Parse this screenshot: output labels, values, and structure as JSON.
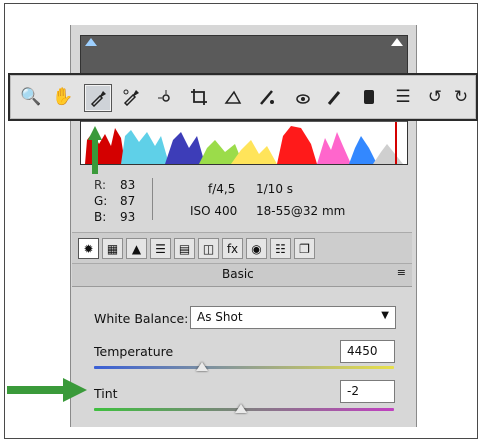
{
  "info": {
    "r_label": "R:",
    "r_value": "83",
    "g_label": "G:",
    "g_value": "87",
    "b_label": "B:",
    "b_value": "93",
    "aperture": "f/4,5",
    "shutter": "1/10 s",
    "iso": "ISO 400",
    "lens": "18-55@32 mm"
  },
  "panel": {
    "title": "Basic",
    "menu_glyph": "≡"
  },
  "white_balance": {
    "label": "White Balance:",
    "value": "As Shot"
  },
  "temperature": {
    "label": "Temperature",
    "value": "4450",
    "level": 0.36
  },
  "tint": {
    "label": "Tint",
    "value": "-2",
    "level": 0.49
  },
  "toolbar": {
    "tools": [
      "zoom-icon",
      "hand-icon",
      "white-balance-eyedropper-icon",
      "color-sampler-icon",
      "targeted-adjustment-icon",
      "crop-icon",
      "straighten-icon",
      "spot-removal-icon",
      "red-eye-icon",
      "adjustment-brush-icon",
      "graduated-filter-icon",
      "preferences-list-icon",
      "rotate-ccw-icon",
      "rotate-cw-icon"
    ],
    "active": "white-balance-eyedropper-icon"
  },
  "colors": {
    "arrow": "#3a9a3a",
    "panel": "#d7d7d7"
  }
}
